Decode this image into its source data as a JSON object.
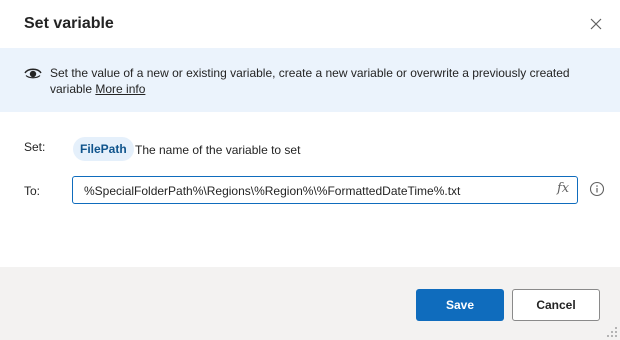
{
  "dialog": {
    "title": "Set variable",
    "close_icon": "close-icon"
  },
  "info": {
    "icon": "eye-icon",
    "text": "Set the value of a new or existing variable, create a new variable or overwrite a previously created variable",
    "link_text": "More info"
  },
  "set_row": {
    "label": "Set:",
    "variable_name": "FilePath",
    "description": "The name of the variable to set"
  },
  "to_row": {
    "label": "To:",
    "value": "%SpecialFolderPath%\\Regions\\%Region%\\%FormattedDateTime%.txt",
    "fx_label": "fx",
    "help_icon": "info-circle-icon"
  },
  "footer": {
    "save_label": "Save",
    "cancel_label": "Cancel"
  },
  "colors": {
    "accent": "#0f6cbd",
    "info_bg": "#ebf3fc",
    "chip_bg": "#e5f0fb",
    "chip_text": "#0f548c",
    "footer_bg": "#f3f2f1"
  }
}
